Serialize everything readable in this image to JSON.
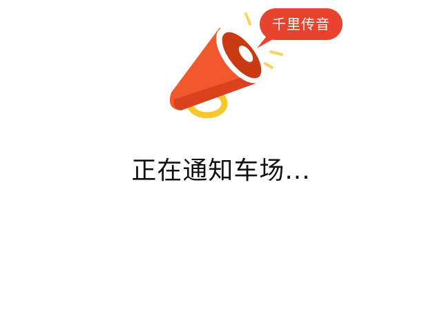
{
  "illustration": {
    "icon": "megaphone-icon",
    "bubble_label": "千里传音",
    "colors": {
      "cone": "#f2582e",
      "cone_dark": "#d9421f",
      "mouth_inner": "#c83a14",
      "handle": "#f7c72e",
      "bubble": "#e8432f",
      "sound_lines": "#f7d45b"
    }
  },
  "status": {
    "message": "正在通知车场..."
  }
}
